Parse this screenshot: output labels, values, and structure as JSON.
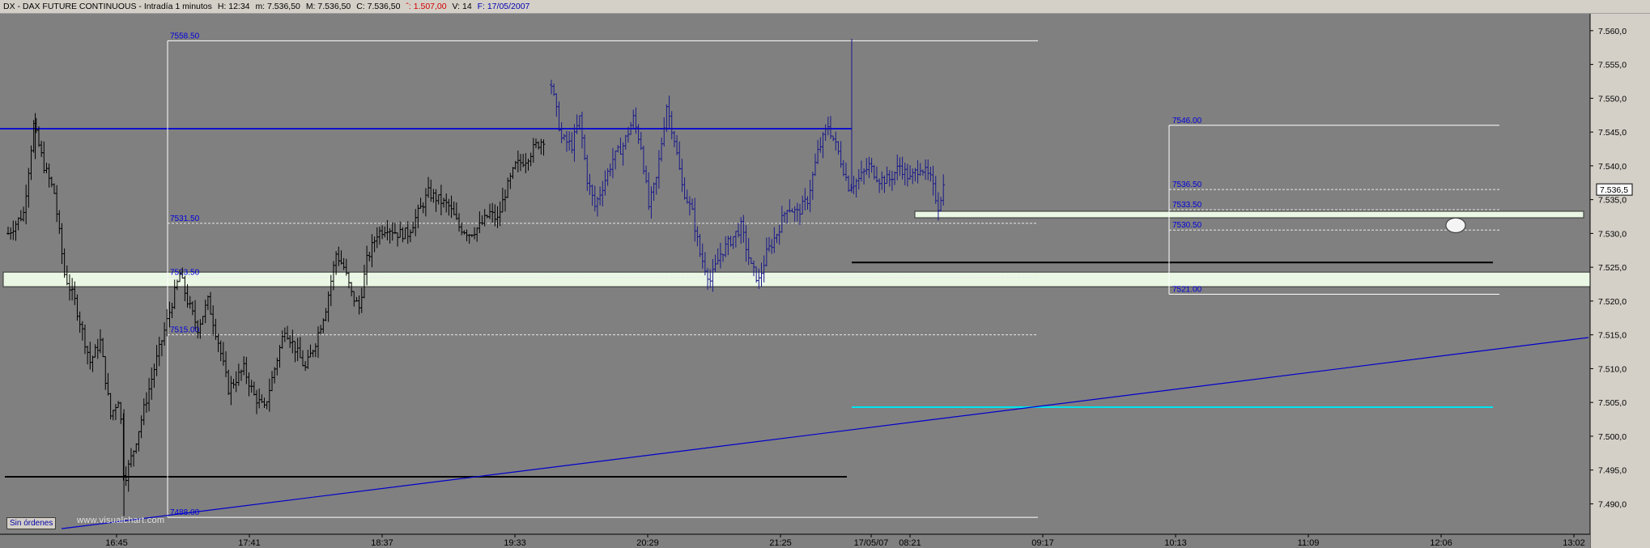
{
  "title_bar": {
    "symbol_name": "DX - DAX FUTURE CONTINUOUS - Intradía 1 minutos",
    "high": "H: 12:34",
    "minimum": "m: 7.536,50",
    "medium": "M: 7.536,50",
    "close": "C: 7.536,50",
    "change": "ˆ: 1.507,00",
    "volume": "V: 14",
    "date": "F: 17/05/2007"
  },
  "buttons": {
    "orders": "Sin órdenes"
  },
  "watermark": "www.visualchart.com",
  "colors": {
    "background": "#808080",
    "axis_panel": "#d4d0c8",
    "bars": "#000000",
    "bars_today": "#1a1a8c",
    "support_band": "#eaf7e4",
    "trendline": "#0000cc",
    "cyan_line": "#00e5ee",
    "labels": "#0000dd"
  },
  "chart_data": {
    "type": "ohlc",
    "x_tick_labels": [
      "16:45",
      "17:41",
      "18:37",
      "19:33",
      "20:29",
      "21:25",
      "17/05/07",
      "08:21",
      "09:17",
      "10:13",
      "11:09",
      "12:06",
      "13:02"
    ],
    "y_tick_labels": [
      "7.560,0",
      "7.555,0",
      "7.550,0",
      "7.545,0",
      "7.540,0",
      "7.535,0",
      "7.530,0",
      "7.525,0",
      "7.520,0",
      "7.515,0",
      "7.510,0",
      "7.505,0",
      "7.500,0",
      "7.495,0",
      "7.490,0"
    ],
    "ylim": [
      7485.5,
      7562.5
    ],
    "last_price_label": "7.536,5",
    "last_price": 7536.5,
    "close_path_previous_session": [
      [
        0,
        7530
      ],
      [
        3,
        7533
      ],
      [
        5,
        7546
      ],
      [
        7,
        7540
      ],
      [
        9,
        7536
      ],
      [
        11,
        7524
      ],
      [
        13,
        7520
      ],
      [
        16,
        7511
      ],
      [
        18,
        7514
      ],
      [
        20,
        7503
      ],
      [
        21.8,
        7506
      ],
      [
        22.4,
        7495
      ],
      [
        22.9,
        7494
      ],
      [
        24.5,
        7498
      ],
      [
        26.5,
        7504
      ],
      [
        28.5,
        7510
      ],
      [
        31,
        7517
      ],
      [
        33.5,
        7524
      ],
      [
        35,
        7520
      ],
      [
        37,
        7516
      ],
      [
        39,
        7520
      ],
      [
        41,
        7514
      ],
      [
        43,
        7507
      ],
      [
        46,
        7510
      ],
      [
        48,
        7506
      ],
      [
        50,
        7504
      ],
      [
        52,
        7510
      ],
      [
        54,
        7516
      ],
      [
        56,
        7513
      ],
      [
        58,
        7510
      ],
      [
        60,
        7514
      ],
      [
        62,
        7519
      ],
      [
        64,
        7527
      ],
      [
        65.5,
        7525
      ],
      [
        67,
        7521
      ],
      [
        68.5,
        7519
      ],
      [
        70,
        7526
      ],
      [
        72,
        7530
      ],
      [
        74,
        7531
      ],
      [
        76,
        7530
      ],
      [
        78,
        7530
      ],
      [
        80,
        7533
      ],
      [
        82,
        7536
      ],
      [
        84,
        7535
      ],
      [
        86,
        7534
      ],
      [
        88,
        7531
      ],
      [
        90,
        7530
      ],
      [
        92,
        7531
      ],
      [
        94,
        7533
      ],
      [
        95.5,
        7532
      ],
      [
        97,
        7536
      ],
      [
        99,
        7540
      ],
      [
        101,
        7541
      ],
      [
        103,
        7543
      ],
      [
        104.5,
        7544
      ]
    ],
    "close_path_current_session": [
      [
        106,
        7552
      ],
      [
        108,
        7544
      ],
      [
        110,
        7543
      ],
      [
        111.5,
        7547
      ],
      [
        113,
        7538
      ],
      [
        114.5,
        7534
      ],
      [
        116,
        7537
      ],
      [
        118,
        7541
      ],
      [
        120,
        7543
      ],
      [
        122,
        7547
      ],
      [
        123.5,
        7543
      ],
      [
        125,
        7534
      ],
      [
        126.5,
        7538
      ],
      [
        128.5,
        7549
      ],
      [
        130,
        7544
      ],
      [
        131.5,
        7537
      ],
      [
        133.5,
        7533
      ],
      [
        135,
        7527
      ],
      [
        137,
        7523
      ],
      [
        139,
        7527
      ],
      [
        141,
        7529
      ],
      [
        143,
        7531
      ],
      [
        145,
        7525
      ],
      [
        146.5,
        7523
      ],
      [
        148,
        7527
      ],
      [
        150,
        7530
      ],
      [
        152,
        7534
      ],
      [
        154,
        7533
      ],
      [
        156,
        7535
      ],
      [
        158,
        7542
      ],
      [
        160,
        7546
      ],
      [
        162,
        7542
      ],
      [
        164,
        7537
      ],
      [
        166,
        7538
      ],
      [
        168,
        7540
      ],
      [
        170,
        7538
      ],
      [
        172,
        7538
      ],
      [
        174,
        7540
      ],
      [
        176,
        7538
      ],
      [
        178,
        7540
      ],
      [
        180,
        7538
      ],
      [
        181.5,
        7534
      ],
      [
        182.5,
        7537
      ]
    ],
    "horizontal_levels": [
      {
        "label": "",
        "price": 7545.5,
        "style": "solid-blue"
      },
      {
        "label": "",
        "price": 7494.0,
        "style": "solid-black"
      },
      {
        "label": "",
        "price": 7525.7,
        "style": "solid-black"
      },
      {
        "label": "",
        "price": 7504.3,
        "style": "solid-cyan"
      },
      {
        "label": "",
        "price": 7532.8,
        "style": "band"
      },
      {
        "label": "",
        "price": 7523.2,
        "style": "band"
      }
    ],
    "range_box_1": {
      "high_label": "7558.50",
      "high": 7558.5,
      "low_label": "7488.00",
      "low": 7488.0,
      "levels": [
        {
          "label": "7531.50",
          "price": 7531.5
        },
        {
          "label": "7523.50",
          "price": 7523.5
        },
        {
          "label": "7515.00",
          "price": 7515.0
        }
      ]
    },
    "range_box_2": {
      "high_label": "7546.00",
      "high": 7546.0,
      "low_label": "7521.00",
      "low": 7521.0,
      "levels": [
        {
          "label": "7536.50",
          "price": 7536.5
        },
        {
          "label": "7533.50",
          "price": 7533.5
        },
        {
          "label": "7530.50",
          "price": 7530.5
        }
      ]
    },
    "trendline": {
      "start_price": 7488.0,
      "end_price": 7514.6
    }
  }
}
